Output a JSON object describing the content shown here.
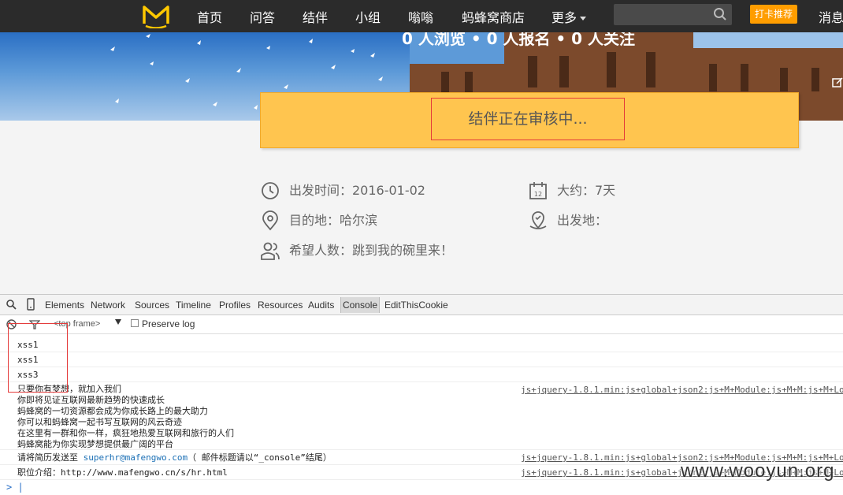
{
  "nav": {
    "items": [
      "首页",
      "问答",
      "结伴",
      "小组",
      "嗡嗡",
      "蚂蜂窝商店",
      "更多"
    ],
    "checkin_label": "打卡推荐",
    "messages_label": "消息"
  },
  "banner": {
    "stats": "0 人浏览 • 0 人报名 • 0 人关注"
  },
  "review": {
    "status_text": "结伴正在审核中..."
  },
  "trip": {
    "depart_time": "出发时间：2016-01-02",
    "duration": "大约：7天",
    "destination": "目的地：哈尔滨",
    "depart_place": "出发地：",
    "wanted_people": "希望人数：跳到我的碗里来！"
  },
  "devtools": {
    "tabs": [
      "Elements",
      "Network",
      "Sources",
      "Timeline",
      "Profiles",
      "Resources",
      "Audits",
      "Console",
      "EditThisCookie"
    ],
    "active_tab": "Console",
    "frame": "<top frame>",
    "preserve_log": "Preserve log",
    "console": {
      "xss_lines": [
        "xss1",
        "xss1",
        "xss3"
      ],
      "message_block": "只要你有梦想，就加入我们\n你即将见证互联网最新趋势的快速成长\n蚂蜂窝的一切资源都会成为你成长路上的最大助力\n你可以和蚂蜂窝一起书写互联网的风云奇迹\n在这里有一群和你一样，疯狂地热爱互联网和旅行的人们\n蚂蜂窝能为你实现梦想提供最广阔的平台",
      "resume_prefix": "请将简历发送至 ",
      "resume_email": "superhr@mafengwo.com",
      "resume_suffix": "（ 邮件标题请以“_console”结尾）",
      "job_line": "职位介绍：http://www.mafengwo.cn/s/hr.html",
      "source": "js+jquery-1.8.1.min:js+global+json2:js+M+Module:js+M+M:js+M+Lo"
    }
  },
  "watermark": "www.wooyun.org",
  "colors": {
    "nav_bg": "#2b2b2b",
    "checkin_orange": "#ff9d00",
    "review_yellow": "#ffc54f",
    "highlight_red": "#e43a3a"
  }
}
